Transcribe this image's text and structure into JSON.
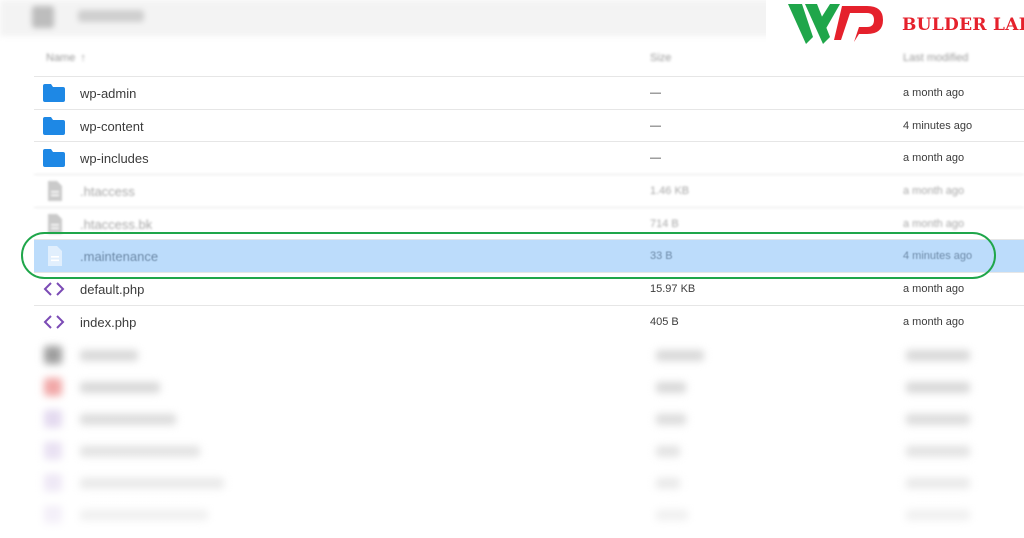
{
  "logo": {
    "text": "BULDER LAB",
    "brand_colors": {
      "green": "#1fa64a",
      "red": "#e5212c"
    }
  },
  "header": {
    "name": "Name",
    "size": "Size",
    "modified": "Last modified",
    "sort_icon": "↑"
  },
  "files": [
    {
      "icon": "folder-icon",
      "name": "wp-admin",
      "size": "—",
      "modified": "a month ago"
    },
    {
      "icon": "folder-icon",
      "name": "wp-content",
      "size": "—",
      "modified": "4 minutes ago"
    },
    {
      "icon": "folder-icon",
      "name": "wp-includes",
      "size": "—",
      "modified": "a month ago"
    },
    {
      "icon": "file-icon",
      "name": ".htaccess",
      "size": "1.46 KB",
      "modified": "a month ago"
    },
    {
      "icon": "file-icon",
      "name": ".htaccess.bk",
      "size": "714 B",
      "modified": "a month ago"
    },
    {
      "icon": "file-icon",
      "name": ".maintenance",
      "size": "33 B",
      "modified": "4 minutes ago",
      "selected": true
    },
    {
      "icon": "code-icon",
      "name": "default.php",
      "size": "15.97 KB",
      "modified": "a month ago"
    },
    {
      "icon": "code-icon",
      "name": "index.php",
      "size": "405 B",
      "modified": "a month ago"
    }
  ],
  "colors": {
    "folder": "#1e88e5",
    "code": "#7b4bb5",
    "file": "#9e9e9e",
    "selected_row": "#bcdcfb",
    "highlight": "#1fa64a"
  }
}
